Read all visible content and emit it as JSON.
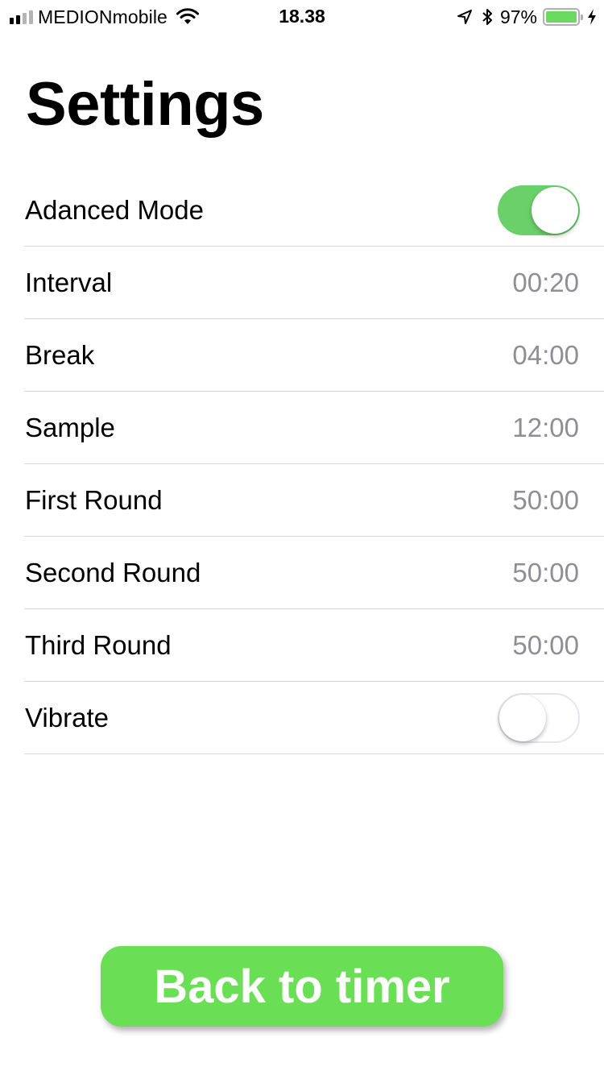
{
  "status_bar": {
    "carrier": "MEDIONmobile",
    "time": "18.38",
    "battery_percent": "97%",
    "signal_bars": 4,
    "signal_bars_filled": 2,
    "battery_level": 0.97,
    "battery_color": "#6bd85f",
    "icons": [
      "signal-icon",
      "wifi-icon",
      "location-arrow-icon",
      "bluetooth-icon",
      "battery-icon",
      "charging-bolt-icon"
    ]
  },
  "page": {
    "title": "Settings"
  },
  "settings": {
    "advanced_mode": {
      "label": "Adanced Mode",
      "enabled": true
    },
    "interval": {
      "label": "Interval",
      "value": "00:20"
    },
    "break": {
      "label": "Break",
      "value": "04:00"
    },
    "sample": {
      "label": "Sample",
      "value": "12:00"
    },
    "first_round": {
      "label": "First Round",
      "value": "50:00"
    },
    "second_round": {
      "label": "Second Round",
      "value": "50:00"
    },
    "third_round": {
      "label": "Third Round",
      "value": "50:00"
    },
    "vibrate": {
      "label": "Vibrate",
      "enabled": false
    }
  },
  "back_button": {
    "label": "Back to timer"
  },
  "colors": {
    "accent_green": "#6ade55",
    "toggle_on": "#6ad06a",
    "value_gray": "#8e8e93",
    "separator": "#d8d8dc"
  }
}
